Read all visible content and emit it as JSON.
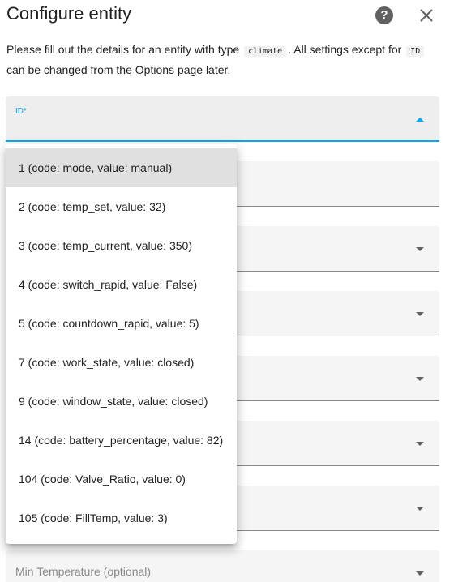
{
  "dialog": {
    "title": "Configure entity",
    "desc_prefix": "Please fill out the details for an entity with type",
    "desc_type": "climate",
    "desc_mid": ". All settings except for",
    "desc_id": "ID",
    "desc_suffix": "can be changed from the Options page later."
  },
  "fields": {
    "id_label": "ID*",
    "min_temp_label": "Min Temperature (optional)"
  },
  "dropdown": {
    "options": [
      "1 (code: mode, value: manual)",
      "2 (code: temp_set, value: 32)",
      "3 (code: temp_current, value: 350)",
      "4 (code: switch_rapid, value: False)",
      "5 (code: countdown_rapid, value: 5)",
      "7 (code: work_state, value: closed)",
      "9 (code: window_state, value: closed)",
      "14 (code: battery_percentage, value: 82)",
      "104 (code: Valve_Ratio, value: 0)",
      "105 (code: FillTemp, value: 3)"
    ],
    "selected_index": 0
  },
  "icons": {
    "help": "help-circle-icon",
    "close": "close-icon"
  },
  "colors": {
    "accent": "#03a9f4",
    "field_bg": "#f5f5f5",
    "selected_bg": "#e0e0e0"
  }
}
